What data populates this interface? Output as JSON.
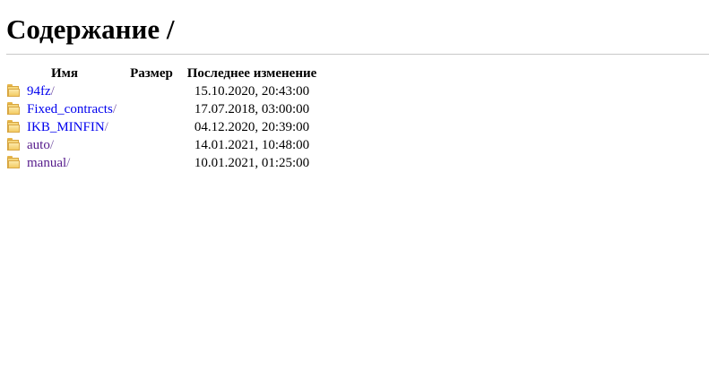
{
  "page": {
    "title": "Содержание /"
  },
  "table": {
    "headers": {
      "name": "Имя",
      "size": "Размер",
      "modified": "Последнее изменение"
    },
    "rows": [
      {
        "name": "94fz",
        "suffix": "/",
        "size": "",
        "modified": "15.10.2020, 20:43:00",
        "visited": false,
        "icon": "folder-icon"
      },
      {
        "name": "Fixed_contracts",
        "suffix": "/",
        "size": "",
        "modified": "17.07.2018, 03:00:00",
        "visited": false,
        "icon": "folder-icon"
      },
      {
        "name": "IKB_MINFIN",
        "suffix": "/",
        "size": "",
        "modified": "04.12.2020, 20:39:00",
        "visited": false,
        "icon": "folder-icon"
      },
      {
        "name": "auto",
        "suffix": "/",
        "size": "",
        "modified": "14.01.2021, 10:48:00",
        "visited": true,
        "icon": "folder-icon"
      },
      {
        "name": "manual",
        "suffix": "/",
        "size": "",
        "modified": "10.01.2021, 01:25:00",
        "visited": true,
        "icon": "folder-icon"
      }
    ]
  },
  "colors": {
    "link": "#0000ee",
    "visited_link": "#551a8b",
    "rule": "#c8c8c8"
  }
}
